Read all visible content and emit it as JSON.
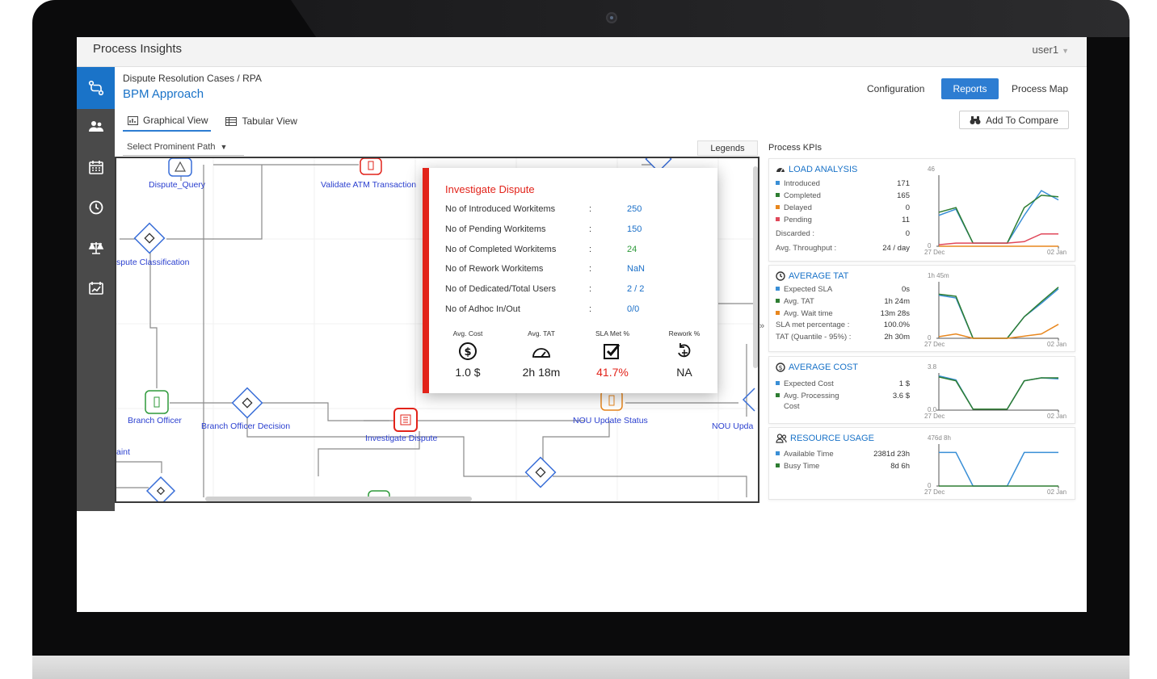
{
  "topbar": {
    "app_title": "Process Insights",
    "user": "user1"
  },
  "header": {
    "breadcrumb": "Dispute Resolution Cases / RPA",
    "title": "BPM Approach",
    "links": {
      "configuration": "Configuration",
      "reports": "Reports",
      "process_map": "Process Map"
    },
    "add_to_compare": "Add To Compare"
  },
  "view_tabs": {
    "graphical": "Graphical View",
    "tabular": "Tabular View"
  },
  "path_select": "Select Prominent Path",
  "legends": "Legends",
  "flow": {
    "labels": {
      "dispute_query": "Dispute_Query",
      "validate_atm": "Validate ATM Transaction",
      "dispute_classification": "spute Classification",
      "branch_officer": "Branch Officer",
      "branch_officer_decision": "Branch Officer Decision",
      "investigate_dispute": "Investigate Dispute",
      "nou_update_status": "NOU Update Status",
      "nou_upda": "NOU Upda",
      "aint": "aint"
    }
  },
  "popup": {
    "title": "Investigate Dispute",
    "separator": ":",
    "rows": [
      {
        "label": "No of Introduced Workitems",
        "value": "250",
        "color": "#1a6fc8"
      },
      {
        "label": "No of Pending Workitems",
        "value": "150",
        "color": "#1a6fc8"
      },
      {
        "label": "No of Completed Workitems",
        "value": "24",
        "color": "#2e9a3a"
      },
      {
        "label": "No of Rework Workitems",
        "value": "NaN",
        "color": "#1a6fc8"
      },
      {
        "label": "No of Dedicated/Total Users",
        "value": "2 / 2",
        "color": "#1a6fc8"
      },
      {
        "label": "No of Adhoc In/Out",
        "value": "0/0",
        "color": "#1a6fc8"
      }
    ],
    "metrics": [
      {
        "label": "Avg. Cost",
        "value": "1.0 $",
        "icon": "dollar-circle-icon"
      },
      {
        "label": "Avg. TAT",
        "value": "2h 18m",
        "icon": "speedometer-icon"
      },
      {
        "label": "SLA Met %",
        "value": "41.7%",
        "icon": "checkbox-icon",
        "color": "#e2231a"
      },
      {
        "label": "Rework %",
        "value": "NA",
        "icon": "rework-cycle-icon"
      }
    ]
  },
  "kpis": {
    "title": "Process KPIs",
    "load_analysis": {
      "title": "LOAD ANALYSIS",
      "rows": [
        {
          "label": "Introduced",
          "value": "171",
          "color": "#3a8fd6"
        },
        {
          "label": "Completed",
          "value": "165",
          "color": "#2e7d32"
        },
        {
          "label": "Delayed",
          "value": "0",
          "color": "#e8871e"
        },
        {
          "label": "Pending",
          "value": "11",
          "color": "#e0485a"
        }
      ],
      "discarded": {
        "label": "Discarded :",
        "value": "0"
      },
      "throughput": {
        "label": "Avg. Throughput :",
        "value": "24 / day"
      }
    },
    "average_tat": {
      "title": "AVERAGE TAT",
      "rows": [
        {
          "label": "Expected SLA",
          "value": "0s",
          "color": "#3a8fd6"
        },
        {
          "label": "Avg. TAT",
          "value": "1h 24m",
          "color": "#2e7d32"
        },
        {
          "label": "Avg. Wait time",
          "value": "13m 28s",
          "color": "#e8871e"
        }
      ],
      "sla_met": {
        "label": "SLA met percentage :",
        "value": "100.0%"
      },
      "tat_quantile": {
        "label": "TAT (Quantile - 95%) :",
        "value": "2h 30m"
      }
    },
    "average_cost": {
      "title": "AVERAGE COST",
      "rows": [
        {
          "label": "Expected Cost",
          "value": "1 $",
          "color": "#3a8fd6"
        },
        {
          "label": "Avg. Processing",
          "value": "3.6 $",
          "color": "#2e7d32"
        }
      ],
      "cost_suffix": "Cost"
    },
    "resource_usage": {
      "title": "RESOURCE USAGE",
      "rows": [
        {
          "label": "Available Time",
          "value": "2381d 23h",
          "color": "#3a8fd6"
        },
        {
          "label": "Busy Time",
          "value": "8d 6h",
          "color": "#2e7d32"
        }
      ]
    }
  },
  "chart_data": [
    {
      "type": "line",
      "title": "LOAD ANALYSIS",
      "x": [
        "27 Dec",
        "",
        "",
        "",
        "",
        "",
        "",
        "02 Jan"
      ],
      "ylim": [
        0,
        46
      ],
      "ytick_labels": [
        "0",
        "46"
      ],
      "series": [
        {
          "name": "Introduced",
          "color": "#3a8fd6",
          "values": [
            20,
            24,
            2,
            2,
            2,
            20,
            36,
            30
          ]
        },
        {
          "name": "Completed",
          "color": "#2e7d32",
          "values": [
            22,
            25,
            2,
            2,
            2,
            25,
            33,
            32
          ]
        },
        {
          "name": "Delayed",
          "color": "#e8871e",
          "values": [
            0,
            0,
            0,
            0,
            0,
            0,
            0,
            0
          ]
        },
        {
          "name": "Pending",
          "color": "#e0485a",
          "values": [
            1,
            2,
            2,
            2,
            2,
            3,
            8,
            8
          ]
        }
      ]
    },
    {
      "type": "line",
      "title": "AVERAGE TAT",
      "x": [
        "27 Dec",
        "",
        "",
        "",
        "",
        "",
        "",
        "02 Jan"
      ],
      "ylim": [
        0,
        105
      ],
      "ytick_labels": [
        "0",
        "1h 45m"
      ],
      "series": [
        {
          "name": "Expected SLA",
          "color": "#3a8fd6",
          "values": [
            80,
            75,
            0,
            0,
            0,
            40,
            65,
            92
          ]
        },
        {
          "name": "Avg. TAT",
          "color": "#2e7d32",
          "values": [
            82,
            78,
            0,
            0,
            0,
            40,
            68,
            95
          ]
        },
        {
          "name": "Avg. Wait time",
          "color": "#e8871e",
          "values": [
            3,
            8,
            0,
            0,
            0,
            4,
            8,
            26
          ]
        }
      ]
    },
    {
      "type": "line",
      "title": "AVERAGE COST",
      "x": [
        "27 Dec",
        "",
        "",
        "",
        "",
        "",
        "",
        "02 Jan"
      ],
      "ylim": [
        0,
        3.8
      ],
      "ytick_labels": [
        "0.0",
        "3.8"
      ],
      "series": [
        {
          "name": "Expected Cost",
          "color": "#3a8fd6",
          "values": [
            3.5,
            3.1,
            0.1,
            0.1,
            0.1,
            3.0,
            3.3,
            3.2
          ]
        },
        {
          "name": "Avg. Processing Cost",
          "color": "#2e7d32",
          "values": [
            3.4,
            3.0,
            0.1,
            0.1,
            0.1,
            3.0,
            3.3,
            3.3
          ]
        }
      ]
    },
    {
      "type": "line",
      "title": "RESOURCE USAGE",
      "x": [
        "27 Dec",
        "",
        "",
        "",
        "",
        "",
        "",
        "02 Jan"
      ],
      "ylim": [
        0,
        100
      ],
      "ytick_labels": [
        "0",
        "476d 8h"
      ],
      "series": [
        {
          "name": "Available Time",
          "color": "#3a8fd6",
          "values": [
            80,
            80,
            0,
            0,
            0,
            80,
            80,
            80
          ]
        },
        {
          "name": "Busy Time",
          "color": "#2e7d32",
          "values": [
            0,
            0,
            0,
            0,
            0,
            0,
            0,
            0
          ]
        }
      ]
    }
  ]
}
